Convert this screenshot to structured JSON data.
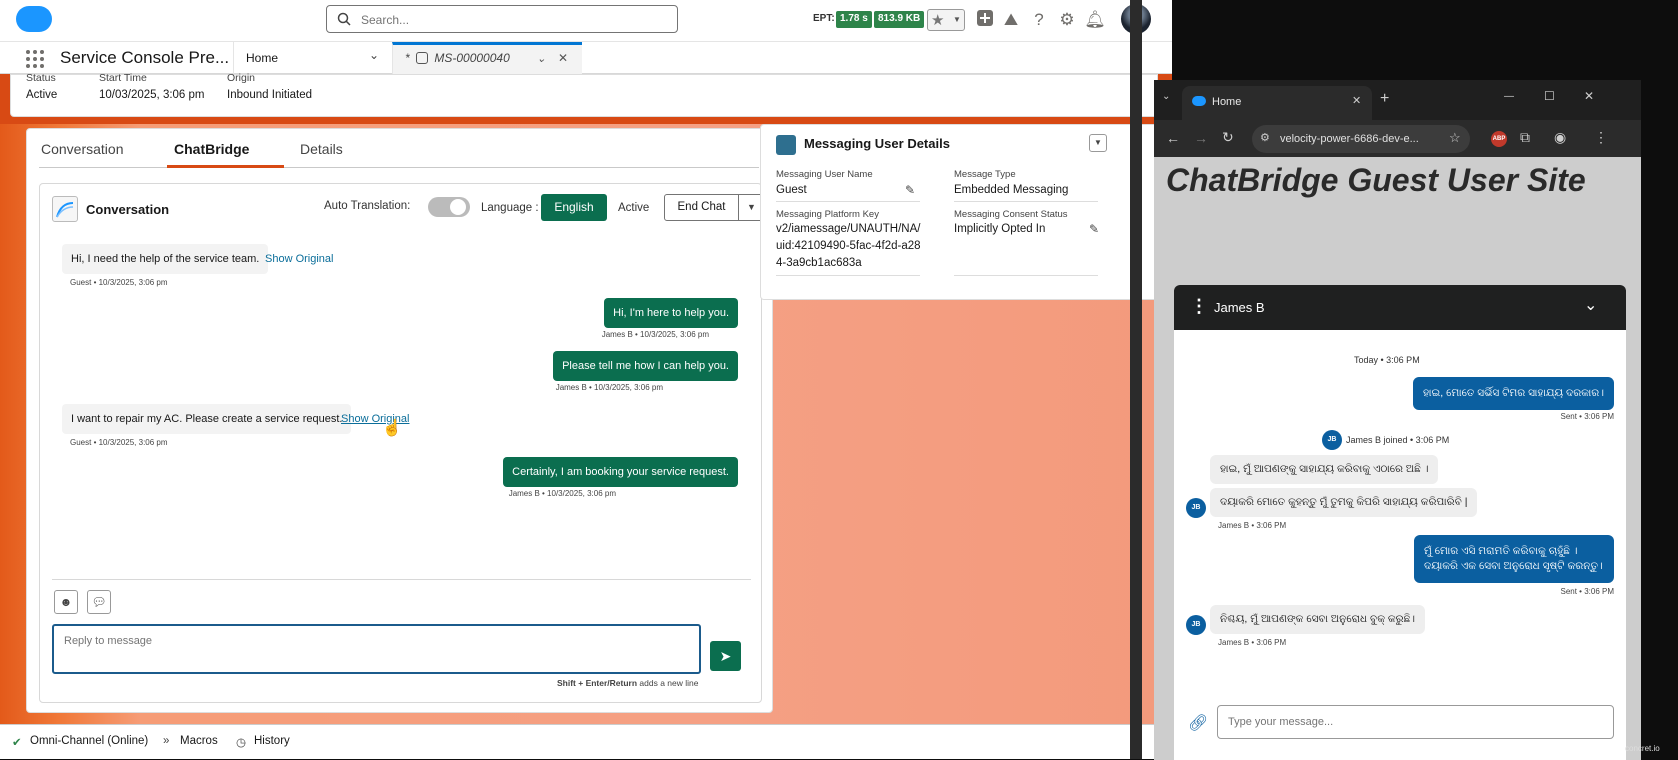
{
  "topbar": {
    "search_placeholder": "Search...",
    "ept_label": "EPT:",
    "ept_time": "1.78 s",
    "ept_size": "813.9 KB"
  },
  "nav": {
    "app_name": "Service Console Pre...",
    "tabs": [
      {
        "label": "Home"
      },
      {
        "label": "MS-00000040"
      }
    ]
  },
  "summary": {
    "fields": [
      {
        "label": "Status",
        "value": "Active"
      },
      {
        "label": "Start Time",
        "value": "10/03/2025, 3:06 pm"
      },
      {
        "label": "Origin",
        "value": "Inbound Initiated"
      }
    ]
  },
  "panel": {
    "tabs": [
      "Conversation",
      "ChatBridge",
      "Details"
    ],
    "active_tab": "ChatBridge"
  },
  "conversation": {
    "title": "Conversation",
    "auto_translation_label": "Auto Translation:",
    "language_label": "Language :",
    "language_value": "English",
    "status": "Active",
    "end_chat_label": "End Chat",
    "messages": [
      {
        "dir": "in",
        "text": "Hi, I need the help of the service team.",
        "meta": "Guest • 10/3/2025, 3:06 pm",
        "show_original": "Show Original"
      },
      {
        "dir": "out",
        "text": "Hi, I'm here to help you.",
        "meta": "James B • 10/3/2025, 3:06 pm"
      },
      {
        "dir": "out",
        "text": "Please tell me how I can help you.",
        "meta": "James B • 10/3/2025, 3:06 pm"
      },
      {
        "dir": "in",
        "text": "I want to repair my AC. Please create a service request.",
        "meta": "Guest • 10/3/2025, 3:06 pm",
        "show_original": "Show Original"
      },
      {
        "dir": "out",
        "text": "Certainly, I am booking your service request.",
        "meta": "James B • 10/3/2025, 3:06 pm"
      }
    ],
    "reply_placeholder": "Reply to message",
    "hint_bold": "Shift + Enter/Return",
    "hint_rest": " adds a new line"
  },
  "details": {
    "title": "Messaging User Details",
    "fields": [
      {
        "label": "Messaging User Name",
        "value": "Guest"
      },
      {
        "label": "Message Type",
        "value": "Embedded Messaging"
      },
      {
        "label": "Messaging Platform Key",
        "value": "v2/iamessage/UNAUTH/NA/uid:42109490-5fac-4f2d-a284-3a9cb1ac683a"
      },
      {
        "label": "Messaging Consent Status",
        "value": "Implicitly Opted In"
      }
    ]
  },
  "utility_bar": {
    "items": [
      "Omni-Channel (Online)",
      "Macros",
      "History"
    ]
  },
  "browser": {
    "tab_title": "Home",
    "url": "velocity-power-6686-dev-e...",
    "site_title": "ChatBridge Guest User Site",
    "chat": {
      "agent_name": "James B",
      "day_label": "Today • 3:06 PM",
      "joined_label": "James B joined • 3:06 PM",
      "avatar_initials": "JB",
      "messages": [
        {
          "dir": "out",
          "text": "ହାଇ, ମୋତେ ସର୍ଭିସ ଟିମର ସାହାଯ୍ୟ ଦରକାର।",
          "meta": "Sent • 3:06 PM"
        },
        {
          "dir": "in",
          "text": "ହାଇ, ମୁଁ ଆପଣଙ୍କୁ ସାହାଯ୍ୟ କରିବାକୁ ଏଠାରେ ଅଛି ।"
        },
        {
          "dir": "in",
          "text": "ଦୟାକରି ମୋତେ କୁହନ୍ତୁ ମୁଁ ତୁମକୁ କିପରି ସାହାଯ୍ୟ କରିପାରିବି |",
          "meta": "James B • 3:06 PM"
        },
        {
          "dir": "out",
          "text": "ମୁଁ ମୋର ଏସି ମରାମତି କରିବାକୁ ଚାହୁଁଛି । ଦୟାକରି ଏକ ସେବା ଅନୁରୋଧ ସୃଷ୍ଟି କରନ୍ତୁ।",
          "meta": "Sent • 3:06 PM"
        },
        {
          "dir": "in",
          "text": "ନିଶ୍ଚୟ, ମୁଁ ଆପଣଙ୍କ ସେବା ଅନୁରୋଧ ବୁକ୍ କରୁଛି।",
          "meta": "James B • 3:06 PM"
        }
      ],
      "input_placeholder": "Type your message..."
    }
  },
  "watermark": "concret.io",
  "colors": {
    "brand_green": "#0b6e4f",
    "chat_blue": "#0b5fa0",
    "accent_orange": "#d84a14"
  }
}
